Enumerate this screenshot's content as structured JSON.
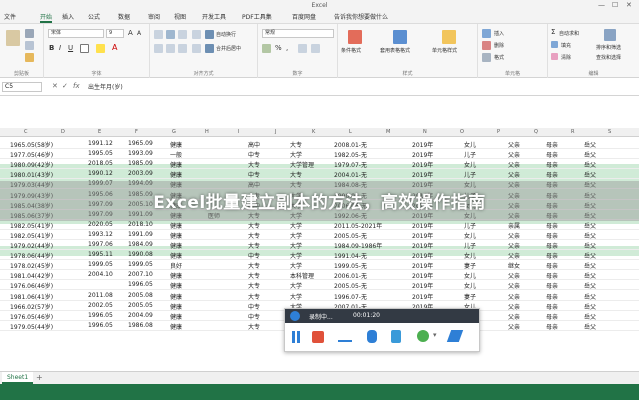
{
  "window": {
    "title": "Excel"
  },
  "menu": {
    "tabs": [
      "文件",
      "开始",
      "插入",
      "公式",
      "数据",
      "审阅",
      "视图",
      "开发工具",
      "PDF工具集",
      "百度网盘",
      "告诉我你想要做什么"
    ],
    "active_index": 1
  },
  "ribbon": {
    "groups": [
      {
        "label": "剪贴板"
      },
      {
        "label": "字体"
      },
      {
        "label": "对齐方式"
      },
      {
        "label": "数字"
      },
      {
        "label": "样式"
      },
      {
        "label": "单元格"
      },
      {
        "label": "编辑"
      }
    ],
    "font_name": "宋体",
    "font_size": "9",
    "number_format": "常规",
    "wrap_text_label": "自动换行",
    "merge_label": "合并后居中",
    "cond_format_label": "条件格式",
    "table_format_label": "套用表格格式",
    "cell_style_label": "单元格样式",
    "insert_label": "插入",
    "delete_label": "删除",
    "format_label": "格式",
    "autosum_label": "自动求和",
    "fill_label": "填充",
    "clear_label": "清除",
    "sort_label": "排序和筛选",
    "find_label": "查找和选择"
  },
  "formula_bar": {
    "name_box": "C5",
    "formula": "出生年月(岁)"
  },
  "grid": {
    "columns": [
      "C",
      "D",
      "E",
      "F",
      "G",
      "H",
      "I",
      "J",
      "K",
      "L",
      "M",
      "N",
      "O",
      "P",
      "Q",
      "R",
      "S",
      "T"
    ],
    "rows": [
      [
        "1965.05(58岁)",
        "1991.12",
        "1965.09",
        "健康",
        "",
        "高中",
        "大专",
        "2008.01-无",
        "",
        "2019年",
        "女儿",
        "父亲",
        "母亲",
        "岳父"
      ],
      [
        "1977.05(46岁)",
        "1995.05",
        "1993.09",
        "一般",
        "",
        "中专",
        "大学",
        "1982.05-无",
        "",
        "2019年",
        "儿子",
        "父亲",
        "母亲",
        "岳父"
      ],
      [
        "1980.09(42岁)",
        "2018.05",
        "1985.09",
        "健康",
        "",
        "大专",
        "大学管理",
        "1979.07-无",
        "",
        "2019年",
        "女儿",
        "父亲",
        "母亲",
        "岳父"
      ],
      [
        "1980.01(43岁)",
        "1990.12",
        "2003.09",
        "健康",
        "",
        "中专",
        "大专",
        "2004.01-无",
        "",
        "2019年",
        "儿子",
        "父亲",
        "母亲",
        "岳父"
      ],
      [
        "1979.03(44岁)",
        "1999.07",
        "1994.09",
        "健康",
        "",
        "高中",
        "大专",
        "1984.08-无",
        "",
        "2019年",
        "女儿",
        "父亲",
        "母亲",
        "岳父"
      ],
      [
        "1979.09(43岁)",
        "1995.06",
        "1985.09",
        "健康",
        "",
        "大专",
        "大学",
        "1990.06-无",
        "",
        "2019年",
        "儿子",
        "父亲",
        "母亲",
        "岳父"
      ],
      [
        "1985.04(38岁)",
        "1997.09",
        "2005.10",
        "健康",
        "",
        "高中",
        "大学",
        "2006.05-无",
        "",
        "2019年",
        "女儿",
        "父亲",
        "母亲",
        "岳父"
      ],
      [
        "1985.06(37岁)",
        "1997.09",
        "1991.09",
        "健康",
        "医师",
        "大专",
        "大学",
        "1992.06-无",
        "",
        "2019年",
        "女儿",
        "父亲",
        "母亲",
        "岳父"
      ],
      [
        "1982.05(41岁)",
        "2020.05",
        "2018.10",
        "健康",
        "",
        "大专",
        "大学",
        "2011.05-2021年",
        "",
        "2019年",
        "儿子",
        "亲属",
        "母亲",
        "岳父"
      ],
      [
        "1982.05(41岁)",
        "1993.12",
        "1991.09",
        "健康",
        "",
        "大专",
        "大学",
        "2005.05-无",
        "",
        "2019年",
        "女儿",
        "父亲",
        "母亲",
        "岳父"
      ],
      [
        "1979.02(44岁)",
        "1997.06",
        "1984.09",
        "健康",
        "",
        "大专",
        "大学",
        "1984.09-1986年",
        "",
        "2019年",
        "儿子",
        "父亲",
        "母亲",
        "岳父"
      ],
      [
        "1978.06(44岁)",
        "1995.11",
        "1990.08",
        "健康",
        "",
        "中专",
        "大学",
        "1991.04-无",
        "",
        "2019年",
        "女儿",
        "父亲",
        "母亲",
        "岳父"
      ],
      [
        "1978.02(45岁)",
        "1999.05",
        "1999.05",
        "良好",
        "",
        "大专",
        "大学",
        "1999.05-无",
        "",
        "2019年",
        "妻子",
        "继女",
        "母亲",
        "岳父"
      ],
      [
        "1981.04(42岁)",
        "2004.10",
        "2007.10",
        "健康",
        "",
        "大专",
        "本科管理",
        "2006.01-无",
        "",
        "2019年",
        "女儿",
        "父亲",
        "母亲",
        "岳父"
      ],
      [
        "1976.06(46岁)",
        "",
        "1996.05",
        "健康",
        "",
        "大专",
        "大学",
        "2005.05-无",
        "",
        "2019年",
        "女儿",
        "父亲",
        "母亲",
        "岳父"
      ],
      [
        "1981.06(41岁)",
        "2011.08",
        "2005.08",
        "健康",
        "",
        "大专",
        "大学",
        "1996.07-无",
        "",
        "2019年",
        "妻子",
        "父亲",
        "母亲",
        "岳父"
      ],
      [
        "1966.02(57岁)",
        "2002.05",
        "2005.05",
        "健康",
        "",
        "中专",
        "大学",
        "2007.01-无",
        "",
        "2019年",
        "女儿",
        "父亲",
        "母亲",
        "岳父"
      ],
      [
        "1976.05(46岁)",
        "1996.05",
        "2004.09",
        "健康",
        "",
        "中专",
        "大学",
        "2006.05-无",
        "",
        "2019年",
        "女儿",
        "父亲",
        "母亲",
        "岳父"
      ],
      [
        "1979.05(44岁)",
        "1996.05",
        "1986.08",
        "健康",
        "",
        "大专",
        "大学管理",
        "2005.09-无",
        "",
        "2019年",
        "儿子",
        "父亲",
        "母亲",
        "岳父"
      ]
    ]
  },
  "banner": {
    "text": "Excel批量建立副本的方法，高效操作指南"
  },
  "recorder": {
    "title": "录制中...",
    "time": "00:01:20"
  },
  "sheets": {
    "tabs": [
      "Sheet1"
    ],
    "add_symbol": "+"
  },
  "colors": {
    "accent": "#217346",
    "band": "#c8e8d0",
    "banner_overlay": "#969696",
    "recorder_header": "#333a44",
    "record_red": "#e0513a",
    "pen_blue": "#2e7fd6"
  }
}
